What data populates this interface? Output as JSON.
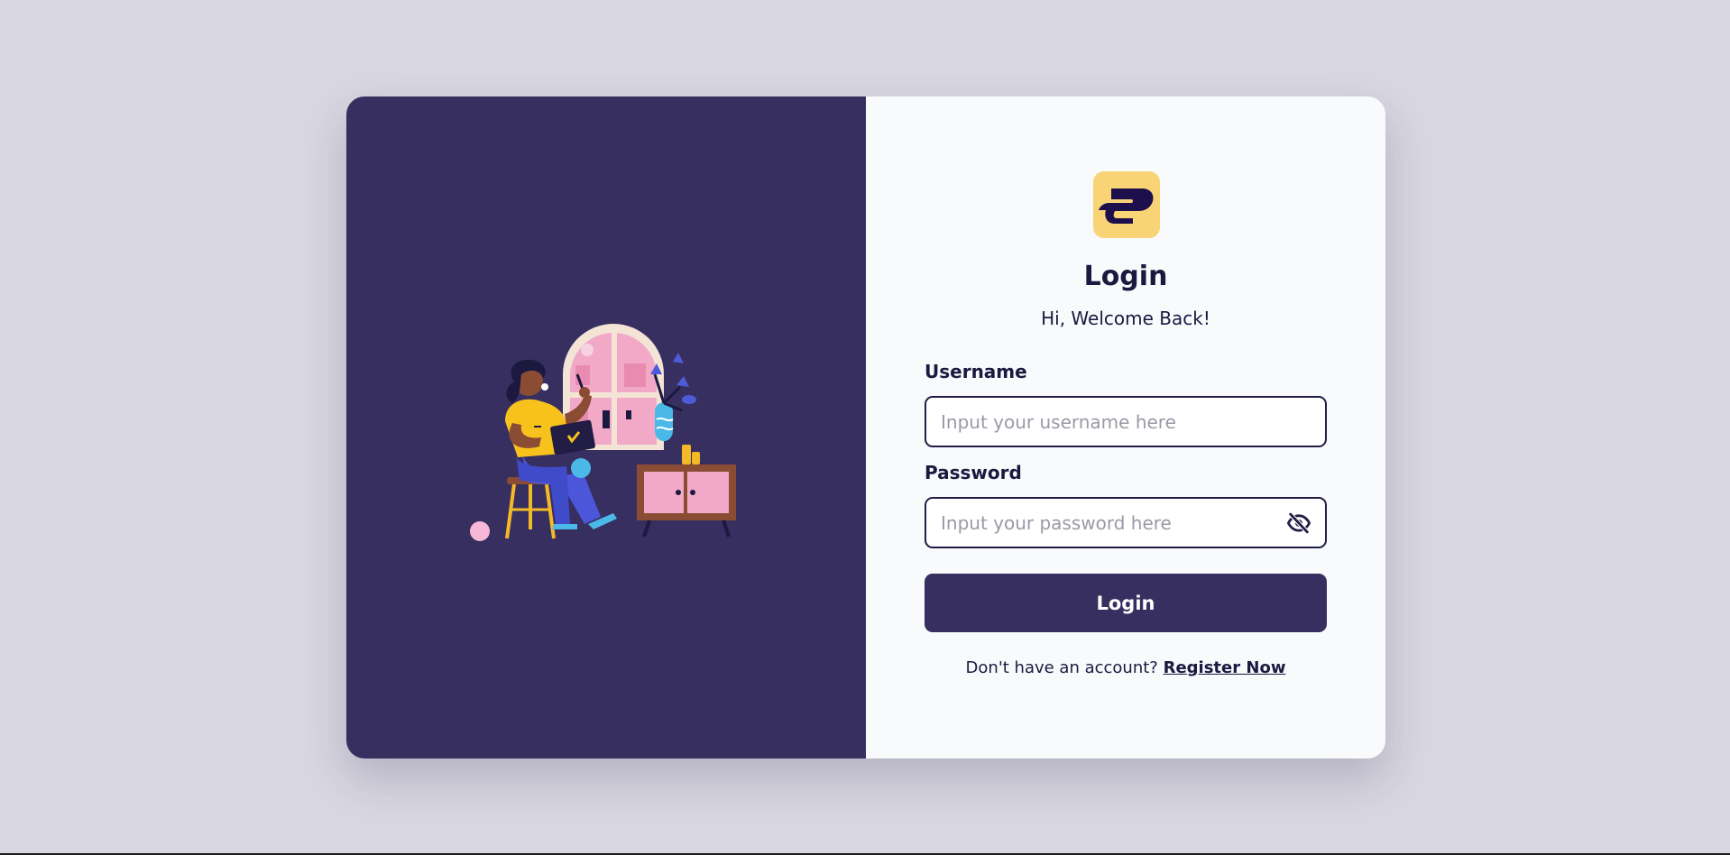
{
  "login": {
    "title": "Login",
    "subtitle": "Hi, Welcome Back!",
    "username_label": "Username",
    "username_placeholder": "Input your username here",
    "username_value": "",
    "password_label": "Password",
    "password_placeholder": "Input your password here",
    "password_value": "",
    "password_toggle_icon": "eye-slash-icon",
    "submit_label": "Login",
    "register_prompt": "Don't have an account?",
    "register_link": "Register Now"
  },
  "brand": {
    "logo_icon": "app-logo-icon",
    "logo_bg": "#f8d477",
    "logo_fg": "#1d0f4b"
  },
  "colors": {
    "page_bg": "#d8d6e0",
    "panel_dark": "#372f60",
    "panel_light": "#f9fafc",
    "text_dark": "#1c1940",
    "placeholder": "#9a9aa6",
    "button_bg": "#372f60"
  },
  "illustration": {
    "icon": "woman-working-on-laptop-illustration"
  }
}
